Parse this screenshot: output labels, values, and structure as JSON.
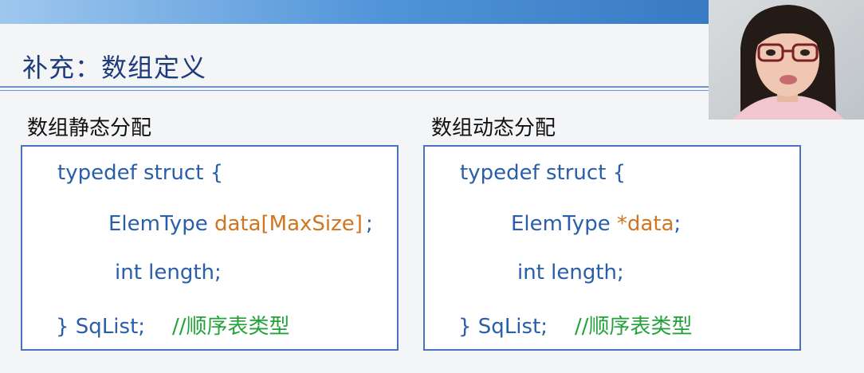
{
  "slide": {
    "title": "补充：数组定义"
  },
  "static_alloc": {
    "label": "数组静态分配",
    "lines": [
      {
        "parts": [
          "typedef struct {"
        ]
      },
      {
        "parts": [
          "ElemType ",
          "data[MaxSize]",
          ";"
        ]
      },
      {
        "parts": [
          "int length;"
        ]
      },
      {
        "parts": [
          "} SqList;",
          "//顺序表类型"
        ]
      }
    ]
  },
  "dynamic_alloc": {
    "label": "数组动态分配",
    "lines": [
      {
        "parts": [
          "typedef struct {"
        ]
      },
      {
        "parts": [
          "ElemType ",
          "*data",
          ";"
        ]
      },
      {
        "parts": [
          "int length;"
        ]
      },
      {
        "parts": [
          "} SqList;",
          "//顺序表类型"
        ]
      }
    ]
  },
  "colors": {
    "keyword": "#2a5ea8",
    "highlight": "#d07520",
    "comment": "#22a33a",
    "box_border": "#4a72c2",
    "title": "#1f3c7a"
  }
}
